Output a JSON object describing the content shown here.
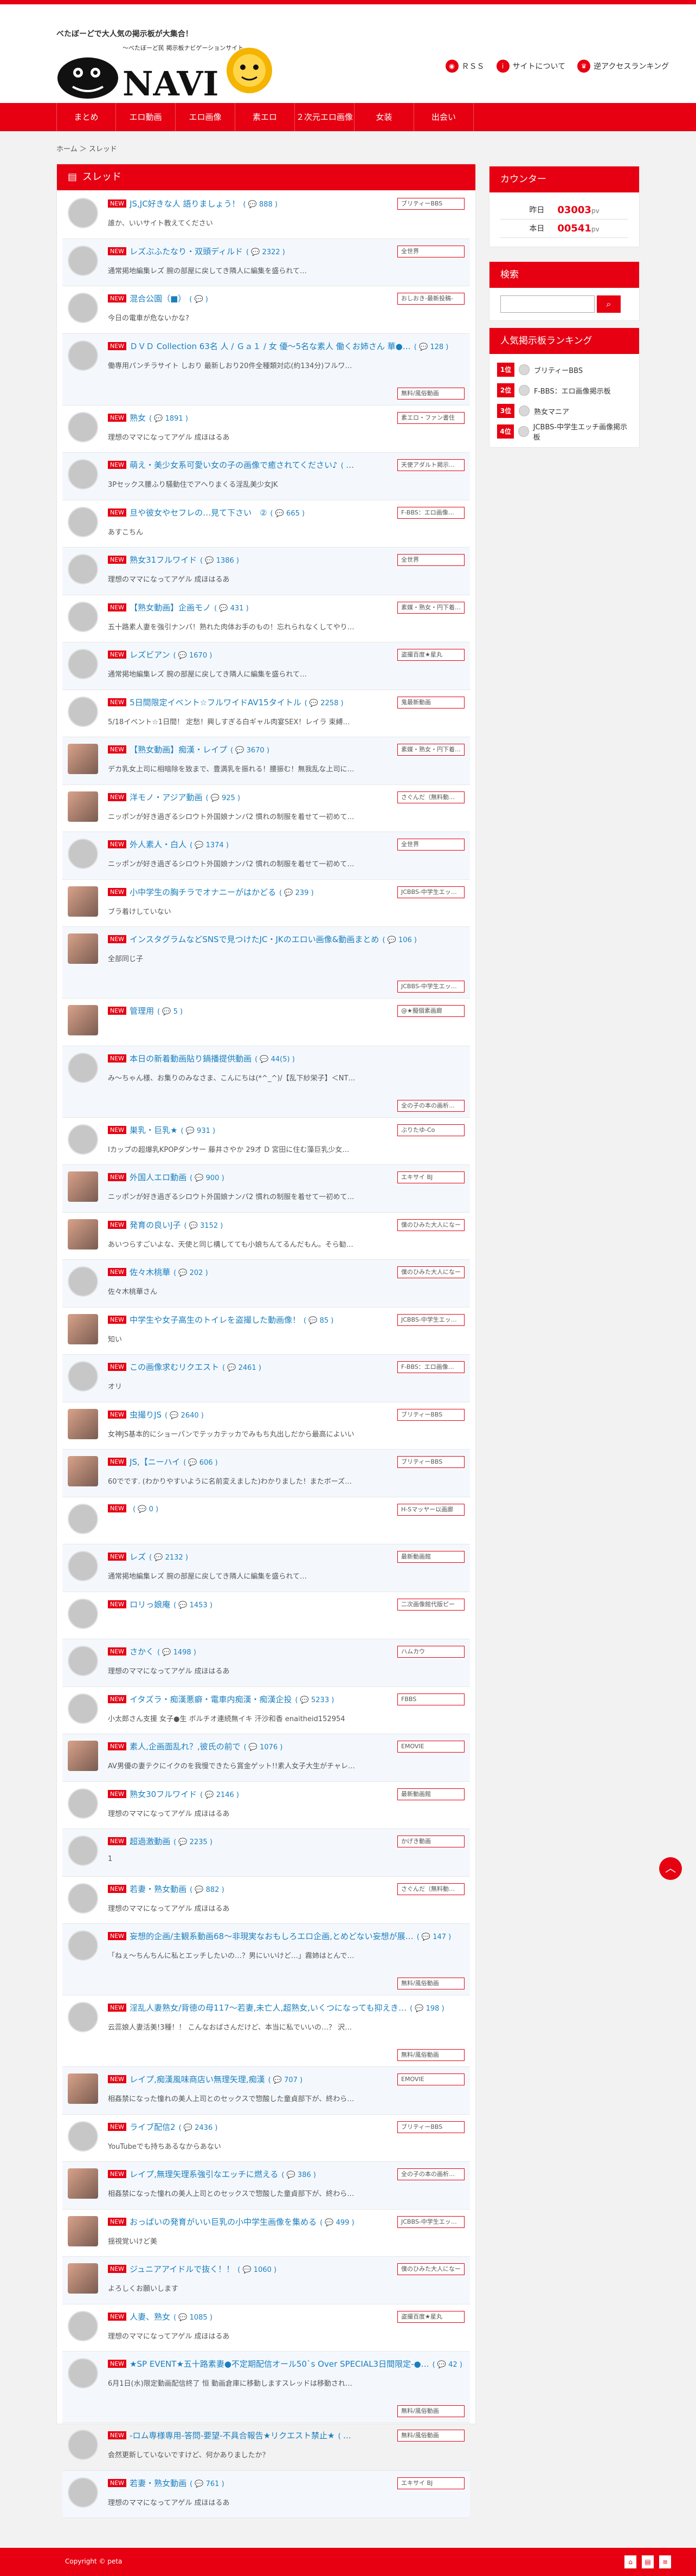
{
  "site": {
    "tagline": "べたぼーどで大人気の掲示板が大集合！",
    "logo_sub": "～べたぼーど民 掲示板ナビゲーションサイト",
    "logo_text": "NAVI"
  },
  "header_links": [
    {
      "label": "ＲＳＳ",
      "icon": "rss-icon"
    },
    {
      "label": "サイトについて",
      "icon": "info-icon"
    },
    {
      "label": "逆アクセスランキング",
      "icon": "ranking-icon"
    }
  ],
  "nav": [
    "まとめ",
    "エロ動画",
    "エロ画像",
    "素エロ",
    "２次元エロ画像",
    "女装",
    "出会い"
  ],
  "breadcrumb": {
    "home": "ホーム",
    "current": "スレッド"
  },
  "main": {
    "title": "スレッド",
    "new_tag": "NEW"
  },
  "threads": [
    {
      "title": "JS,JC好きな人 語りましょう！",
      "count": "888",
      "excerpt": "誰か、いいサイト教えてください",
      "board": "ブリティーBBS"
    },
    {
      "title": "レズぶふたなり・双頭ディルド",
      "count": "2322",
      "excerpt": "通常掲地編集レズ 腕の部屋に戻してき隣人に編集を盛られて…",
      "board": "全世界"
    },
    {
      "title": "混合公園（■）",
      "count": "",
      "excerpt": "今日の電車が危ないかな?",
      "board": "おしおき-最新投稿-"
    },
    {
      "title": "ＤＶＤ Collection 63名 人 / Ｇａ１ / 女 優～5名な素人 働くお姉さん 華●…",
      "count": "128",
      "excerpt": "働専用パンチラサイト しおり 最新しおり20件全種類対応(約134分)フルワイド高画質＊…",
      "board": "無料/風俗動画",
      "tall": true
    },
    {
      "title": "熟女",
      "count": "1891",
      "excerpt": "理想のママになってアゲル 成ほはるあ",
      "board": "素エロ・ファン書住"
    },
    {
      "title": "萌え・美少女系可愛い女の子の画像で癒されてください♪",
      "count": "1506",
      "excerpt": "3Pセックス腰ふり騒動住でアヘりまくる淫乱美少女JK",
      "board": "天使アダルト掲示…"
    },
    {
      "title": "旦や彼女やセフレの…見て下さい　②",
      "count": "665",
      "excerpt": "あすこちん",
      "board": "F-BBS：エロ画像…"
    },
    {
      "title": "熟女31フルワイド",
      "count": "1386",
      "excerpt": "理想のママになってアゲル 成ほはるあ",
      "board": "全世界"
    },
    {
      "title": "【熟女動画】企画モノ",
      "count": "431",
      "excerpt": "五十路素人妻を強引ナンパ！熟れた肉体お手のもの！忘れられなくしてやりま…",
      "board": "素媒・熟女・円下着…"
    },
    {
      "title": "レズビアン",
      "count": "1670",
      "excerpt": "通常掲地編集レズ 腕の部屋に戻してき隣人に編集を盛られて…",
      "board": "盗撮百度★星丸"
    },
    {
      "title": "5日間限定イベント☆フルワイドAV15タイトル",
      "count": "2258",
      "excerpt": "5/18イベント☆1日間！ 定愁！興しすぎる白ギャル肉宴SEX！レイラ 束縛調望ある子…",
      "board": "鬼最新動画"
    },
    {
      "title": "【熟女動画】痴漢・レイプ",
      "count": "3670",
      "excerpt": "デカ乳女上司に相暗除を致まで、豊満乳を振れる！腰振む！無我乱な上司に毎ど…",
      "board": "素媒・熟女・円下着…",
      "photo": true
    },
    {
      "title": "洋モノ・アジア動画",
      "count": "925",
      "excerpt": "ニッポンが好き過ぎるシロウト外国娘ナンパ2 慣れの制服を着せて一初めての日本…",
      "board": "さぐんだ（無料動…",
      "photo": true
    },
    {
      "title": "外人素人・白人",
      "count": "1374",
      "excerpt": "ニッポンが好き過ぎるシロウト外国娘ナンパ2 慣れの制服を着せて一初めての日本…",
      "board": "全世界"
    },
    {
      "title": "小中学生の胸チラでオナニーがはかどる",
      "count": "239",
      "excerpt": "ブラ着けしていない",
      "board": "JCBBS-中学生エッ…",
      "photo": true
    },
    {
      "title": "インスタグラムなどSNSで見つけたJC・JKのエロい画像&動画まとめ",
      "count": "106",
      "excerpt": "全部同じ子",
      "board": "JCBBS-中学生エッ…",
      "tall": true,
      "photo": true
    },
    {
      "title": "管理用",
      "count": "5",
      "excerpt": "",
      "board": "@★擬個素画廊",
      "photo": true
    },
    {
      "title": "本日の新着動画貼り鍋播提供動画",
      "count": "44(5)",
      "excerpt": "み～ちゃん様、お集りのみなさま、こんにちは(*^_^)/【乱下紗栄子】＜NTR＞巨乳妻…",
      "board": "全の子の本の画析…",
      "tall": true
    },
    {
      "title": "巣乳・巨乳★",
      "count": "931",
      "excerpt": "Iカップの超爆乳KPOPダンサー 藤井さやか 29才 D 宮田に住む藻巨乳少女に会いに行…",
      "board": "ぶりたゆ-Co"
    },
    {
      "title": "外国人エロ動画",
      "count": "900",
      "excerpt": "ニッポンが好き過ぎるシロウト外国娘ナンパ2 慣れの制服を着せて一初めての日本…",
      "board": "エキサイ BJ",
      "photo": true
    },
    {
      "title": "発育の良いJ子",
      "count": "3152",
      "excerpt": "あいつらすごいよな、天使と同じ構してても小娘ちんてるんだもん。そら勧援で…",
      "board": "僕のひみた大人になー",
      "photo": true
    },
    {
      "title": "佐々木桃華",
      "count": "202",
      "excerpt": "佐々木桃華さん",
      "board": "僕のひみた大人になー"
    },
    {
      "title": "中学生や女子高生のトイレを盗撮した動画像！",
      "count": "85",
      "excerpt": "知い",
      "board": "JCBBS-中学生エッ…",
      "photo": true
    },
    {
      "title": "この画像求むリクエスト",
      "count": "2461",
      "excerpt": "オリ",
      "board": "F-BBS：エロ画像…"
    },
    {
      "title": "虫撮りJS",
      "count": "2640",
      "excerpt": "女神JS基本的にショーパンでテッカテッカでみもち丸出しだから最高によいい",
      "board": "ブリティーBBS",
      "photo": true
    },
    {
      "title": "JS,【ニーハイ",
      "count": "606",
      "excerpt": "60でです. (わかりやすいように名前変えました)わかりました！またボーズのリクエ…",
      "board": "ブリティーBBS",
      "photo": true
    },
    {
      "title": "",
      "count": "0",
      "excerpt": "",
      "board": "H-Sマッヤー以画廊"
    },
    {
      "title": "レズ",
      "count": "2132",
      "excerpt": "通常掲地編集レズ 腕の部屋に戻してき隣人に編集を盛られて…",
      "board": "最新動画館"
    },
    {
      "title": "ロリっ娘庵",
      "count": "1453",
      "excerpt": "",
      "board": "二次画像館代版ピー"
    },
    {
      "title": "さかく",
      "count": "1498",
      "excerpt": "理想のママになってアゲル 成ほはるあ",
      "board": "ハムカウ"
    },
    {
      "title": "イタズラ・痴漢悪癖・電車内痴漢・痴漢企投",
      "count": "5233",
      "excerpt": "小太郎さん支援 女子●生 ボルチオ連続無イキ 汗沙和香 enaitheid152954",
      "board": "FBBS"
    },
    {
      "title": "素人,企画面乱れ？,彼氏の前で",
      "count": "1076",
      "excerpt": "AV男優の妻テクにイクのを我慢できたら賞金ゲット!!素人女子大生がチャレンジに…",
      "board": "EMOVIE",
      "photo": true
    },
    {
      "title": "熟女30フルワイド",
      "count": "2146",
      "excerpt": "理想のママになってアゲル 成ほはるあ",
      "board": "最新動画館"
    },
    {
      "title": "超過激動画",
      "count": "2235",
      "excerpt": "1",
      "board": "かげき動画"
    },
    {
      "title": "若妻・熟女動画",
      "count": "882",
      "excerpt": "理想のママになってアゲル 成ほはるあ",
      "board": "さぐんだ（無料動…"
    },
    {
      "title": "妄想的企画/主観系動画68～非現実なおもしろエロ企画,とめどない妄想が展…",
      "count": "147",
      "excerpt": "「ねぇ～ちんちんに私とエッチしたいの…？男にいいけど…」霧姉はとんでもない…",
      "board": "無料/風俗動画",
      "tall": true
    },
    {
      "title": "淫乱人妻熟女/背徳の母117～若妻,未亡人,超熟女,いくつになっても抑えき…",
      "count": "198",
      "excerpt": "云蕊娘人妻活美!3種！！ こんなおばさんだけど、本当に私でいいの…？ 沢田敏学20…",
      "board": "無料/風俗動画",
      "tall": true
    },
    {
      "title": "レイプ,痴漢風味商店い無理矢理,痴漢",
      "count": "707",
      "excerpt": "相姦禁になった憧れの美人上司とのセックスで惣酸した童貞部下が、終わらない…",
      "board": "EMOVIE",
      "photo": true
    },
    {
      "title": "ライブ配信2",
      "count": "2436",
      "excerpt": "YouTubeでも持ちあるなからあない",
      "board": "ブリティーBBS"
    },
    {
      "title": "レイプ,無理矢理系強引なエッチに燃える",
      "count": "386",
      "excerpt": "相姦禁になった憧れの美人上司とのセックスで惣酸した童貞部下が、終わらない…",
      "board": "全の子の本の画析…",
      "photo": true
    },
    {
      "title": "おっぱいの発育がいい巨乳の小中学生画像を集める",
      "count": "499",
      "excerpt": "揺視覚いけど美",
      "board": "JCBBS-中学生エッ…",
      "photo": true
    },
    {
      "title": "ジュニアアイドルで抜く！！",
      "count": "1060",
      "excerpt": "よろしくお願いします",
      "board": "僕のひみた大人になー",
      "photo": true
    },
    {
      "title": "人妻、熟女",
      "count": "1085",
      "excerpt": "理想のママになってアゲル 成ほはるあ",
      "board": "盗撮百度★星丸"
    },
    {
      "title": "★SP EVENT★五十路素妻●不定期配信オール50`s Over SPECIAL3日間限定-●…",
      "count": "42",
      "excerpt": "6月1日(水)限定動画配信終了 恒 動画倉庫に移動しますスレッドは移動されません…",
      "board": "無料/風俗動画",
      "tall": true
    },
    {
      "title": "-ロム専様専用-答問-要望-不具合報告★リクエスト禁止★",
      "count": "627",
      "excerpt": "会然更新していないですけど、何かありましたか？",
      "board": "無料/風俗動画"
    },
    {
      "title": "若妻・熟女動画",
      "count": "761",
      "excerpt": "理想のママになってアゲル 成ほはるあ",
      "board": "エキサイ BJ"
    }
  ],
  "counter": {
    "title": "カウンター",
    "yesterday_label": "昨日",
    "yesterday_value": "03003",
    "today_label": "本日",
    "today_value": "00541",
    "unit": "pv"
  },
  "search": {
    "title": "検索",
    "placeholder": "",
    "button_icon": "search-icon"
  },
  "ranking": {
    "title": "人気掲示板ランキング",
    "items": [
      {
        "rank": "1位",
        "name": "ブリティーBBS"
      },
      {
        "rank": "2位",
        "name": "F-BBS：エロ画像掲示板"
      },
      {
        "rank": "3位",
        "name": "熟女マニア"
      },
      {
        "rank": "4位",
        "name": "JCBBS-中学生エッチ画像掲示板"
      }
    ]
  },
  "footer": {
    "copyright": "Copyright ©  peta"
  },
  "colors": {
    "accent": "#e60012",
    "link": "#1a7fbf"
  }
}
